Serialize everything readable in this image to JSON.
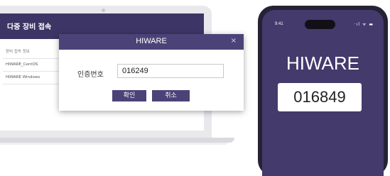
{
  "laptop": {
    "app_title": "다중 장비 접속",
    "table": {
      "header": "장비 접속 정보",
      "rows": [
        "HIWARE_CentOS",
        "HIWARE Windows"
      ]
    }
  },
  "dialog": {
    "title": "HIWARE",
    "close_symbol": "×",
    "auth_label": "인증번호",
    "auth_value": "016249",
    "ok_label": "확인",
    "cancel_label": "취소"
  },
  "phone": {
    "time": "9:41",
    "status_icons": "·ıl ᯤ ▬",
    "title": "HIWARE",
    "code": "016849"
  },
  "colors": {
    "header": "#3d3565",
    "dialog_bar": "#4b4378",
    "phone_screen": "#443a6c"
  }
}
